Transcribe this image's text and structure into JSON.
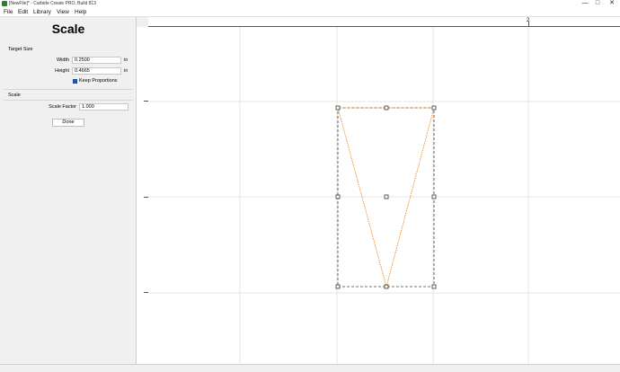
{
  "window": {
    "title": "[NewFile]* - Carbide Create PRO, Build 813",
    "controls": {
      "minimize": "—",
      "maximize": "□",
      "close": "✕"
    }
  },
  "menubar": {
    "items": [
      "File",
      "Edit",
      "Library",
      "View",
      "Help"
    ]
  },
  "panel": {
    "title": "Scale",
    "target_size_label": "Target Size",
    "width_label": "Width",
    "width_value": "0.2500",
    "width_unit": "in",
    "height_label": "Height",
    "height_value": "0.4665",
    "height_unit": "in",
    "keep_proportions_label": "Keep Proportions",
    "keep_proportions_checked": true,
    "scale_section_label": "Scale",
    "scale_factor_label": "Scale Factor",
    "scale_factor_value": "1.000",
    "done_label": "Done"
  },
  "canvas": {
    "ruler_label": "2",
    "shape": "inverted-triangle",
    "shape_color": "#f28c28",
    "selection_color": "#444444",
    "grid_color": "#dcdcdc"
  }
}
